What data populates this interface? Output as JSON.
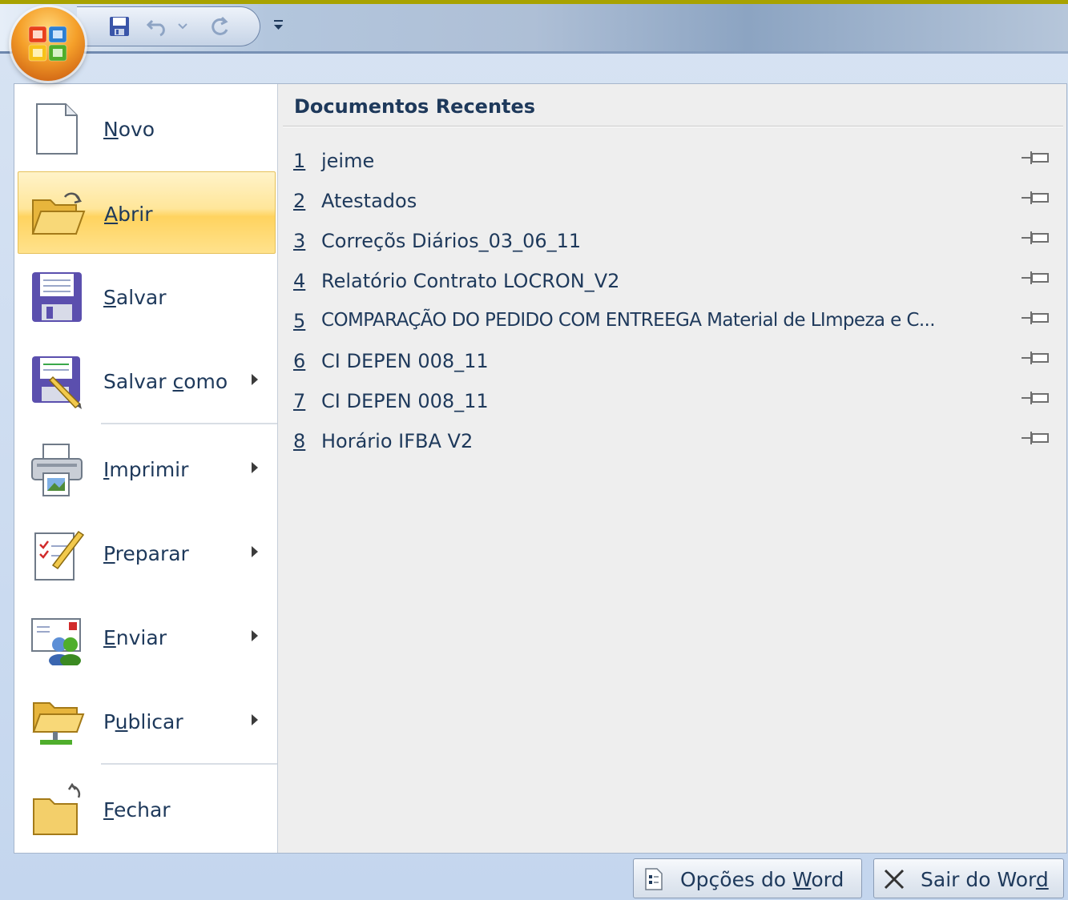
{
  "quick_access": {
    "save_icon": "save-icon",
    "undo_icon": "undo-icon",
    "redo_icon": "redo-icon",
    "customize_icon": "customize-qat-icon"
  },
  "left_menu": [
    {
      "key": "novo",
      "accel": "N",
      "rest": "ovo",
      "icon": "new-document-icon",
      "submenu": false
    },
    {
      "key": "abrir",
      "accel": "A",
      "rest": "brir",
      "icon": "open-folder-icon",
      "submenu": false,
      "active": true
    },
    {
      "key": "salvar",
      "accel": "S",
      "rest": "alvar",
      "icon": "save-disk-icon",
      "submenu": false
    },
    {
      "key": "salvar_como",
      "pre": "Salvar ",
      "accel": "c",
      "rest": "omo",
      "icon": "save-as-icon",
      "submenu": true
    },
    {
      "key": "imprimir",
      "accel": "I",
      "rest": "mprimir",
      "icon": "printer-icon",
      "submenu": true
    },
    {
      "key": "preparar",
      "accel": "P",
      "rest": "reparar",
      "icon": "prepare-icon",
      "submenu": true
    },
    {
      "key": "enviar",
      "accel": "E",
      "rest": "nviar",
      "icon": "send-icon",
      "submenu": true
    },
    {
      "key": "publicar",
      "pre": "P",
      "accel": "u",
      "rest": "blicar",
      "icon": "publish-icon",
      "submenu": true
    },
    {
      "key": "fechar",
      "accel": "F",
      "rest": "echar",
      "icon": "close-folder-icon",
      "submenu": false
    }
  ],
  "recent": {
    "title": "Documentos Recentes",
    "items": [
      {
        "num": "1",
        "name": "jeime"
      },
      {
        "num": "2",
        "name": "Atestados"
      },
      {
        "num": "3",
        "name": "Correçõs Diários_03_06_11"
      },
      {
        "num": "4",
        "name": "Relatório Contrato LOCRON_V2"
      },
      {
        "num": "5",
        "name": "COMPARAÇÃO DO PEDIDO COM ENTREEGA Material de LImpeza e C..."
      },
      {
        "num": "6",
        "name": "CI DEPEN 008_11"
      },
      {
        "num": "7",
        "name": "CI DEPEN 008_11"
      },
      {
        "num": "8",
        "name": "Horário IFBA V2"
      }
    ]
  },
  "footer": {
    "options_pre": "Opções do ",
    "options_accel": "W",
    "options_rest": "ord",
    "exit_pre": "Sair do Wor",
    "exit_accel": "d",
    "exit_rest": ""
  }
}
